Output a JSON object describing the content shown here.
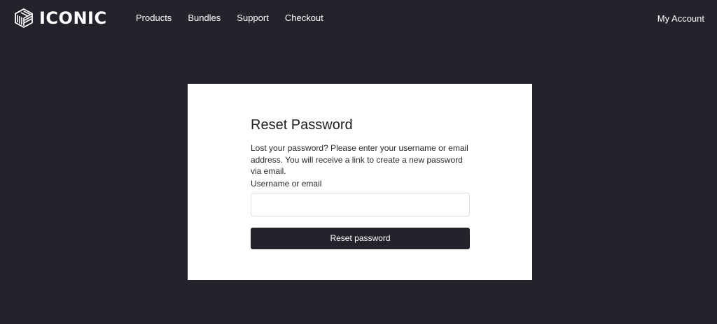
{
  "header": {
    "logo_text": "ICONIC",
    "nav": [
      {
        "label": "Products"
      },
      {
        "label": "Bundles"
      },
      {
        "label": "Support"
      },
      {
        "label": "Checkout"
      }
    ],
    "account_label": "My Account"
  },
  "reset_form": {
    "title": "Reset Password",
    "description": "Lost your password? Please enter your username or email address. You will receive a link to create a new password via email.",
    "field_label": "Username or email",
    "field_value": "",
    "button_label": "Reset password"
  },
  "colors": {
    "background": "#24232c",
    "card": "#ffffff",
    "button": "#24232c",
    "text_on_dark": "#ffffff"
  },
  "icons": {
    "logo": "iconic-cube-logo-icon"
  }
}
